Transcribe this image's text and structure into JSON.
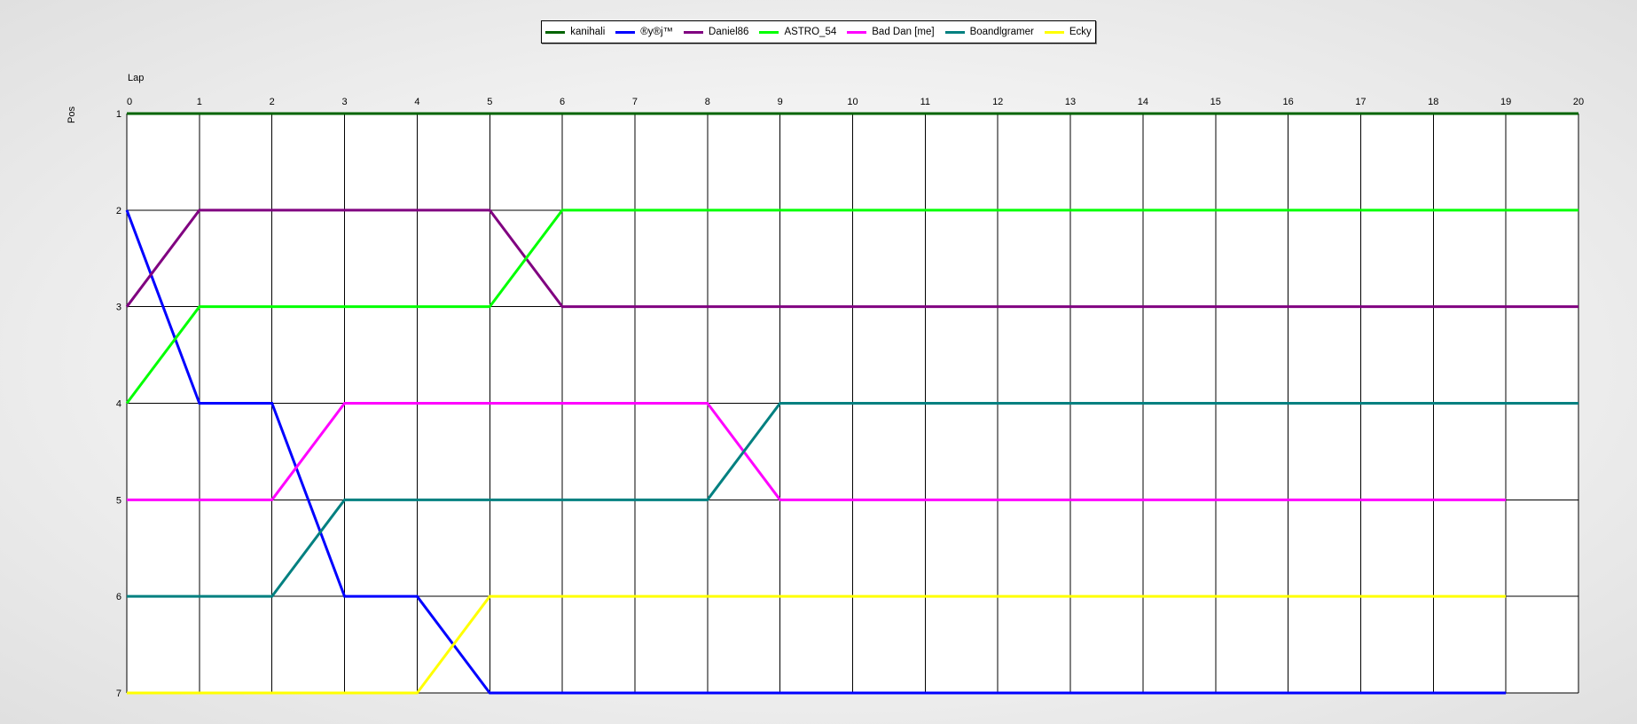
{
  "chart_data": {
    "type": "line",
    "xlabel": "Lap",
    "ylabel": "Pos",
    "xlim": [
      0,
      20
    ],
    "ylim": [
      1,
      7
    ],
    "y_inverted": true,
    "x": [
      0,
      1,
      2,
      3,
      4,
      5,
      6,
      7,
      8,
      9,
      10,
      11,
      12,
      13,
      14,
      15,
      16,
      17,
      18,
      19,
      20
    ],
    "yticks": [
      1,
      2,
      3,
      4,
      5,
      6,
      7
    ],
    "grid": true,
    "legend_position": "top-center",
    "series": [
      {
        "name": "kanihali",
        "color": "#006400",
        "values": [
          1,
          1,
          1,
          1,
          1,
          1,
          1,
          1,
          1,
          1,
          1,
          1,
          1,
          1,
          1,
          1,
          1,
          1,
          1,
          1,
          1
        ]
      },
      {
        "name": "®y®j™",
        "color": "#0000ff",
        "values": [
          2,
          4,
          4,
          6,
          6,
          7,
          7,
          7,
          7,
          7,
          7,
          7,
          7,
          7,
          7,
          7,
          7,
          7,
          7,
          7
        ]
      },
      {
        "name": "Daniel86",
        "color": "#800080",
        "values": [
          3,
          2,
          2,
          2,
          2,
          2,
          3,
          3,
          3,
          3,
          3,
          3,
          3,
          3,
          3,
          3,
          3,
          3,
          3,
          3,
          3
        ]
      },
      {
        "name": "ASTRO_54",
        "color": "#00ff00",
        "values": [
          4,
          3,
          3,
          3,
          3,
          3,
          2,
          2,
          2,
          2,
          2,
          2,
          2,
          2,
          2,
          2,
          2,
          2,
          2,
          2,
          2
        ]
      },
      {
        "name": "Bad Dan [me]",
        "color": "#ff00ff",
        "values": [
          5,
          5,
          5,
          4,
          4,
          4,
          4,
          4,
          4,
          5,
          5,
          5,
          5,
          5,
          5,
          5,
          5,
          5,
          5,
          5
        ]
      },
      {
        "name": "Boandlgramer",
        "color": "#008080",
        "values": [
          6,
          6,
          6,
          5,
          5,
          5,
          5,
          5,
          5,
          4,
          4,
          4,
          4,
          4,
          4,
          4,
          4,
          4,
          4,
          4,
          4
        ]
      },
      {
        "name": "Ecky",
        "color": "#ffff00",
        "values": [
          7,
          7,
          7,
          7,
          7,
          6,
          6,
          6,
          6,
          6,
          6,
          6,
          6,
          6,
          6,
          6,
          6,
          6,
          6,
          6
        ]
      }
    ]
  }
}
